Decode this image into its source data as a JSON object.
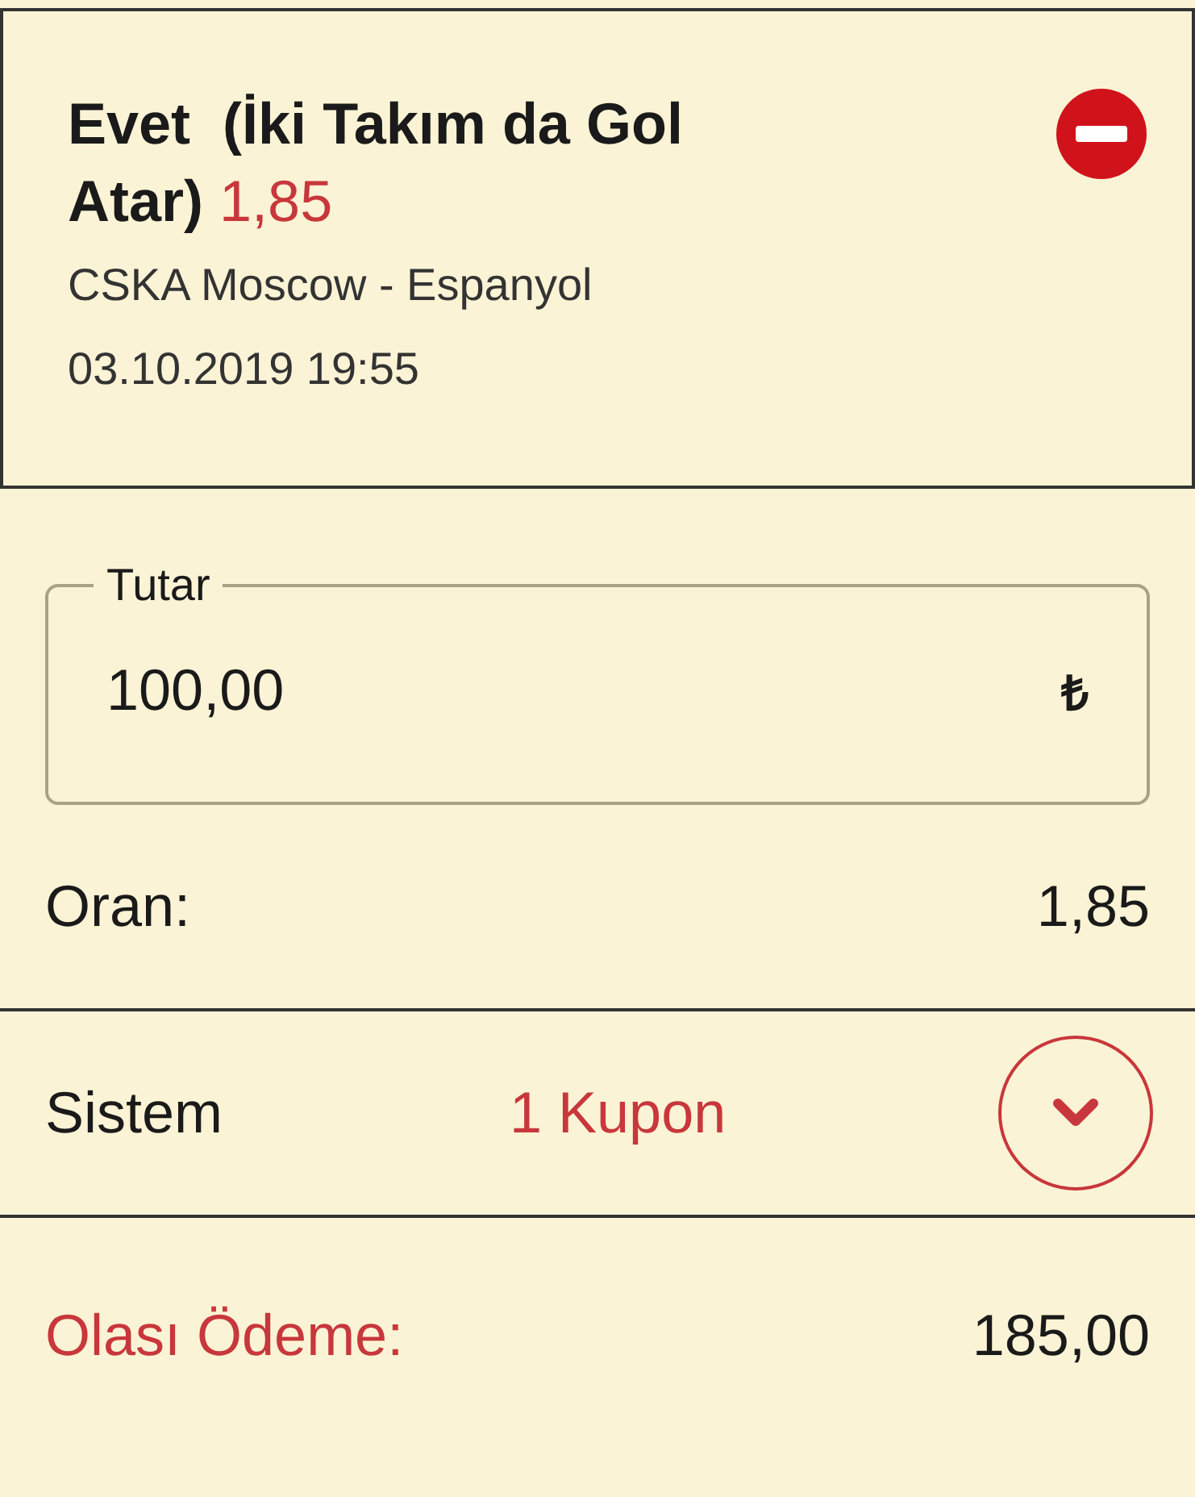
{
  "selection": {
    "title": "Evet  (İki Takım da Gol Atar)",
    "odds": "1,85",
    "match": "CSKA Moscow - Espanyol",
    "datetime": "03.10.2019 19:55"
  },
  "stake": {
    "label": "Tutar",
    "value": "100,00",
    "currency": "₺"
  },
  "odds_row": {
    "label": "Oran:",
    "value": "1,85"
  },
  "system": {
    "label": "Sistem",
    "value": "1 Kupon",
    "expanded": false
  },
  "payout": {
    "label": "Olası Ödeme:",
    "value": "185,00"
  }
}
